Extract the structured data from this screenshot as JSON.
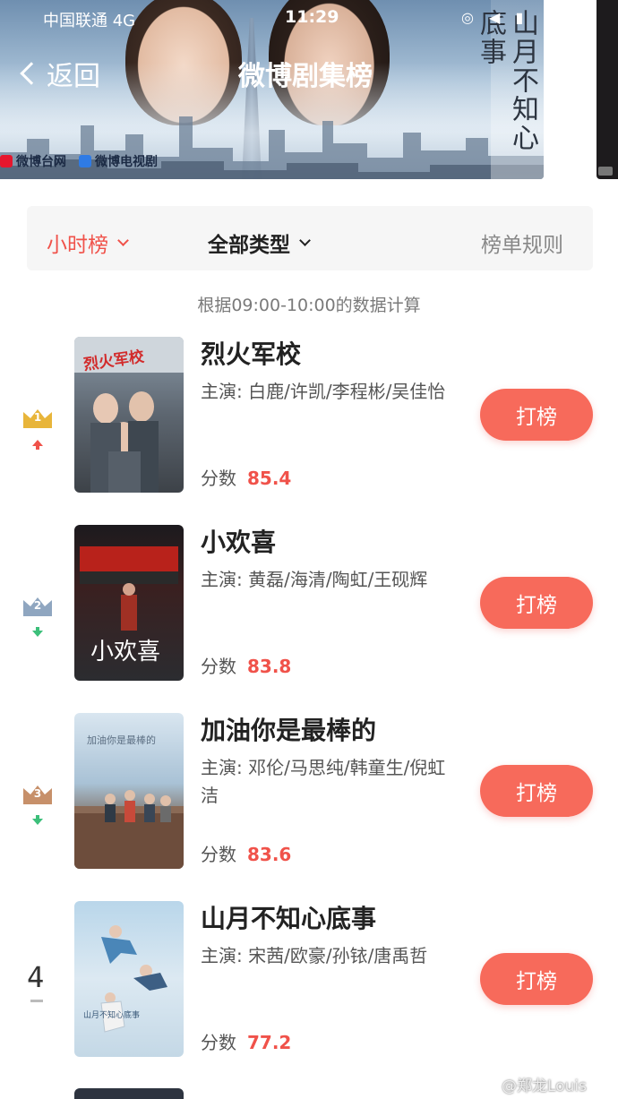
{
  "status_bar": {
    "carrier": "中国联通  4G",
    "time": "11:29"
  },
  "header": {
    "back_label": "返回",
    "title": "微博剧集榜",
    "poster_title": "山月不知心底事",
    "logos": [
      "微博台网",
      "微博电视剧"
    ]
  },
  "filters": {
    "hour_label": "小时榜",
    "type_label": "全部类型",
    "rules_label": "榜单规则"
  },
  "data_note": "根据09:00-10:00的数据计算",
  "ranking": [
    {
      "rank": "1",
      "trend": "up",
      "name": "烈火军校",
      "cast": "主演: 白鹿/许凯/李程彬/吴佳怡",
      "score_label": "分数",
      "score": "85.4",
      "button": "打榜",
      "poster_text": "烈火军校"
    },
    {
      "rank": "2",
      "trend": "down",
      "name": "小欢喜",
      "cast": "主演: 黄磊/海清/陶虹/王砚辉",
      "score_label": "分数",
      "score": "83.8",
      "button": "打榜",
      "poster_text": "小欢喜"
    },
    {
      "rank": "3",
      "trend": "down",
      "name": "加油你是最棒的",
      "cast": "主演: 邓伦/马思纯/韩童生/倪虹洁",
      "score_label": "分数",
      "score": "83.6",
      "button": "打榜",
      "poster_text": "加油你是最棒的"
    },
    {
      "rank": "4",
      "trend": "same",
      "name": "山月不知心底事",
      "cast": "主演: 宋茜/欧豪/孙铱/唐禹哲",
      "score_label": "分数",
      "score": "77.2",
      "button": "打榜",
      "poster_text": "山月不知心底事"
    }
  ],
  "watermark": "@郑龙Louis",
  "colors": {
    "accent": "#f0524a",
    "button": "#f76a5b",
    "gold": "#e8b53a",
    "silver": "#8fa6c0",
    "bronze": "#c7906a",
    "up": "#f0524a",
    "down": "#3cbf7a"
  }
}
